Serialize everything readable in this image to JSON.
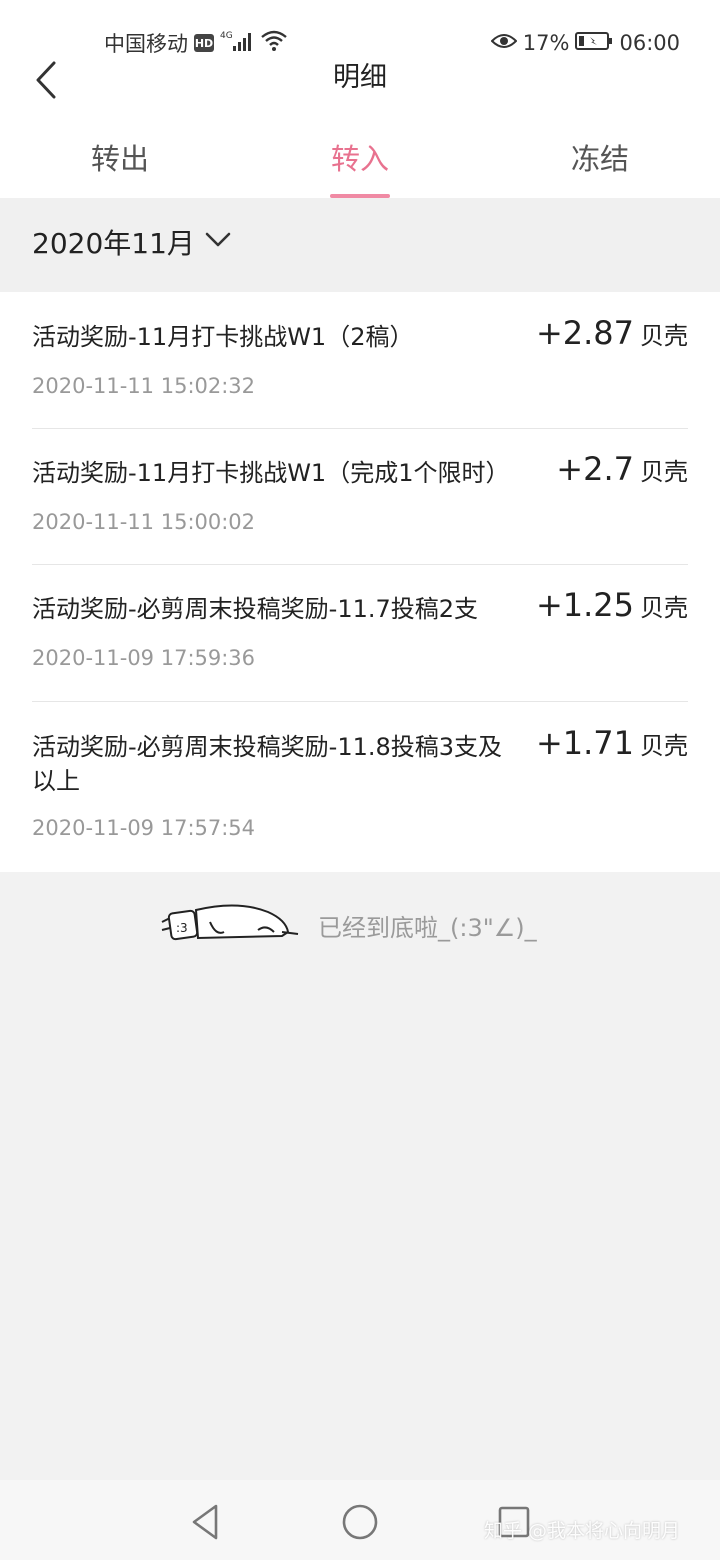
{
  "status_bar": {
    "carrier": "中国移动",
    "hd": "HD",
    "network": "4G",
    "battery": "17%",
    "time": "06:00"
  },
  "header": {
    "title": "明细"
  },
  "tabs": [
    {
      "label": "转出",
      "active": false
    },
    {
      "label": "转入",
      "active": true
    },
    {
      "label": "冻结",
      "active": false
    }
  ],
  "month": {
    "label": "2020年11月"
  },
  "transactions": [
    {
      "title": "活动奖励-11月打卡挑战W1（2稿）",
      "time": "2020-11-11 15:02:32",
      "amount": "+2.87",
      "unit": "贝壳"
    },
    {
      "title": "活动奖励-11月打卡挑战W1（完成1个限时）",
      "time": "2020-11-11 15:00:02",
      "amount": "+2.7",
      "unit": "贝壳"
    },
    {
      "title": "活动奖励-必剪周末投稿奖励-11.7投稿2支",
      "time": "2020-11-09 17:59:36",
      "amount": "+1.25",
      "unit": "贝壳"
    },
    {
      "title_line1": "活动奖励-必剪周末投稿奖励-11.8投稿3支及",
      "title_line2": "以上",
      "time": "2020-11-09 17:57:54",
      "amount": "+1.71",
      "unit": "贝壳"
    }
  ],
  "footer": {
    "end_text": "已经到底啦_(:3\"∠)_"
  },
  "watermark": "知乎 @我本将心向明月",
  "colors": {
    "accent": "#e8728f",
    "background": "#f2f2f2"
  }
}
